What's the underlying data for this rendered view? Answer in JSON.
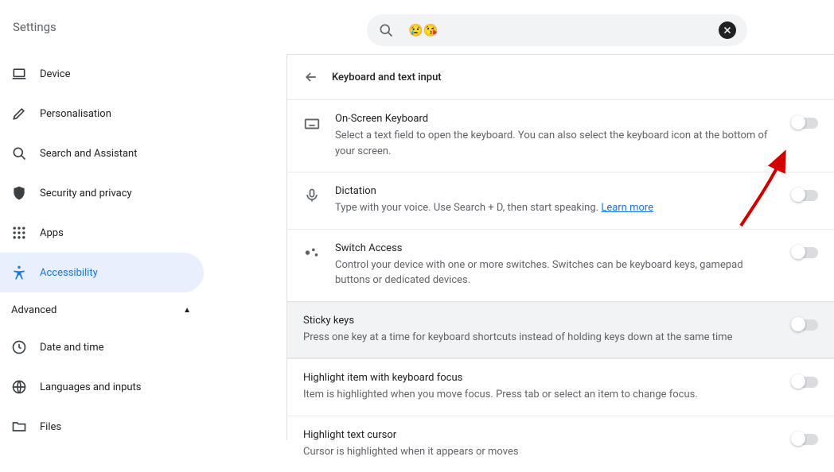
{
  "header": {
    "title": "Settings",
    "search_value": "😢😘"
  },
  "sidebar": {
    "items": [
      {
        "label": "Device",
        "icon": "laptop"
      },
      {
        "label": "Personalisation",
        "icon": "edit"
      },
      {
        "label": "Search and Assistant",
        "icon": "search"
      },
      {
        "label": "Security and privacy",
        "icon": "shield"
      },
      {
        "label": "Apps",
        "icon": "apps"
      },
      {
        "label": "Accessibility",
        "icon": "accessibility"
      }
    ],
    "advanced_label": "Advanced",
    "advanced_items": [
      {
        "label": "Date and time",
        "icon": "clock"
      },
      {
        "label": "Languages and inputs",
        "icon": "globe"
      },
      {
        "label": "Files",
        "icon": "folder"
      }
    ]
  },
  "page": {
    "title": "Keyboard and text input",
    "rows": [
      {
        "key": "onscreen",
        "title": "On-Screen Keyboard",
        "desc": "Select a text field to open the keyboard. You can also select the keyboard icon at the bottom of your screen.",
        "icon": "keyboard"
      },
      {
        "key": "dictation",
        "title": "Dictation",
        "desc_pre": "Type with your voice. Use Search + D, then start speaking.  ",
        "learn_more": "Learn more",
        "icon": "mic"
      },
      {
        "key": "switch",
        "title": "Switch Access",
        "desc": "Control your device with one or more switches. Switches can be keyboard keys, gamepad buttons or dedicated devices.",
        "icon": "switch"
      }
    ],
    "sticky": {
      "title": "Sticky keys",
      "desc": "Press one key at a time for keyboard shortcuts instead of holding keys down at the same time"
    },
    "focus": {
      "title": "Highlight item with keyboard focus",
      "desc": "Item is highlighted when you move focus. Press tab or select an item to change focus."
    },
    "cursor": {
      "title": "Highlight text cursor",
      "desc": "Cursor is highlighted when it appears or moves"
    }
  }
}
